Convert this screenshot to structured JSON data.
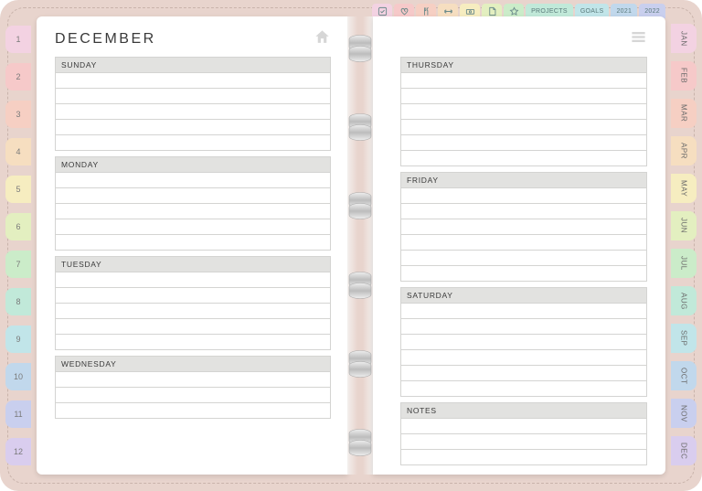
{
  "title": "DECEMBER",
  "left_days": [
    "SUNDAY",
    "MONDAY",
    "TUESDAY",
    "WEDNESDAY"
  ],
  "right_days": [
    "THURSDAY",
    "FRIDAY",
    "SATURDAY",
    "NOTES"
  ],
  "left_tabs": [
    {
      "label": "1",
      "bg": "#f3d2e2"
    },
    {
      "label": "2",
      "bg": "#f6c9c9"
    },
    {
      "label": "3",
      "bg": "#f6cfc3"
    },
    {
      "label": "4",
      "bg": "#f6dec0"
    },
    {
      "label": "5",
      "bg": "#f6edc0"
    },
    {
      "label": "6",
      "bg": "#e3efc0"
    },
    {
      "label": "7",
      "bg": "#cbecc9"
    },
    {
      "label": "8",
      "bg": "#c1e9d9"
    },
    {
      "label": "9",
      "bg": "#c1e5e9"
    },
    {
      "label": "10",
      "bg": "#c1d8ec"
    },
    {
      "label": "11",
      "bg": "#c9cfee"
    },
    {
      "label": "12",
      "bg": "#d9cdee"
    }
  ],
  "right_tabs": [
    {
      "label": "JAN",
      "bg": "#f3d2e2"
    },
    {
      "label": "FEB",
      "bg": "#f6c9c9"
    },
    {
      "label": "MAR",
      "bg": "#f6cfc3"
    },
    {
      "label": "APR",
      "bg": "#f6dec0"
    },
    {
      "label": "MAY",
      "bg": "#f6edc0"
    },
    {
      "label": "JUN",
      "bg": "#e3efc0"
    },
    {
      "label": "JUL",
      "bg": "#cbecc9"
    },
    {
      "label": "AUG",
      "bg": "#c1e9d9"
    },
    {
      "label": "SEP",
      "bg": "#c1e5e9"
    },
    {
      "label": "OCT",
      "bg": "#c1d8ec"
    },
    {
      "label": "NOV",
      "bg": "#c9cfee"
    },
    {
      "label": "DEC",
      "bg": "#d9cdee"
    }
  ],
  "top_tabs": [
    {
      "icon": "check",
      "bg": "#f3d2e2"
    },
    {
      "icon": "heart",
      "bg": "#f6c9c9"
    },
    {
      "icon": "cutlery",
      "bg": "#f6cfc3"
    },
    {
      "icon": "dumbbell",
      "bg": "#f6dec0"
    },
    {
      "icon": "money",
      "bg": "#f6edc0"
    },
    {
      "icon": "note",
      "bg": "#e3efc0"
    },
    {
      "icon": "star",
      "bg": "#cbecc9"
    },
    {
      "label": "PROJECTS",
      "bg": "#c1e9d9"
    },
    {
      "label": "GOALS",
      "bg": "#c1e5e9"
    },
    {
      "label": "2021",
      "bg": "#c1d8ec"
    },
    {
      "label": "2022",
      "bg": "#c9cfee"
    }
  ]
}
